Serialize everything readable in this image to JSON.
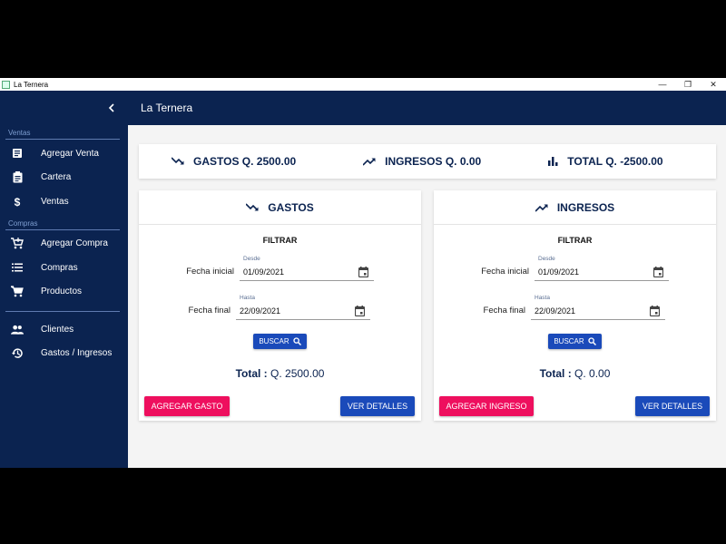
{
  "window": {
    "title": "La Ternera",
    "controls": [
      "—",
      "❐",
      "✕"
    ]
  },
  "sidebar": {
    "sections": [
      {
        "label": "Ventas",
        "items": [
          {
            "label": "Agregar Venta",
            "icon": "receipt-icon"
          },
          {
            "label": "Cartera",
            "icon": "clipboard-icon"
          },
          {
            "label": "Ventas",
            "icon": "dollar-icon"
          }
        ]
      },
      {
        "label": "Compras",
        "items": [
          {
            "label": "Agregar Compra",
            "icon": "cart-add-icon"
          },
          {
            "label": "Compras",
            "icon": "list-icon"
          },
          {
            "label": "Productos",
            "icon": "cart-icon"
          }
        ]
      },
      {
        "label": "",
        "items": [
          {
            "label": "Clientes",
            "icon": "people-icon"
          },
          {
            "label": "Gastos / Ingresos",
            "icon": "history-icon"
          }
        ]
      }
    ]
  },
  "appbar": {
    "title": "La Ternera"
  },
  "summary": {
    "gastos": "GASTOS Q. 2500.00",
    "ingresos": "INGRESOS Q. 0.00",
    "total": "TOTAL Q. -2500.00"
  },
  "gastos_card": {
    "title": "GASTOS",
    "filtrar": "FILTRAR",
    "fecha_inicial_label": "Fecha inicial",
    "desde_label": "Desde",
    "desde_value": "01/09/2021",
    "fecha_final_label": "Fecha final",
    "hasta_label": "Hasta",
    "hasta_value": "22/09/2021",
    "buscar": "BUSCAR",
    "total_label": "Total :",
    "total_value": "Q. 2500.00",
    "add_button": "AGREGAR GASTO",
    "details_button": "VER DETALLES"
  },
  "ingresos_card": {
    "title": "INGRESOS",
    "filtrar": "FILTRAR",
    "fecha_inicial_label": "Fecha inicial",
    "desde_label": "Desde",
    "desde_value": "01/09/2021",
    "fecha_final_label": "Fecha final",
    "hasta_label": "Hasta",
    "hasta_value": "22/09/2021",
    "buscar": "BUSCAR",
    "total_label": "Total :",
    "total_value": "Q. 0.00",
    "add_button": "AGREGAR INGRESO",
    "details_button": "VER DETALLES"
  },
  "colors": {
    "navy": "#0b2350",
    "pink": "#ee0f5e",
    "blue": "#1a4aba"
  }
}
